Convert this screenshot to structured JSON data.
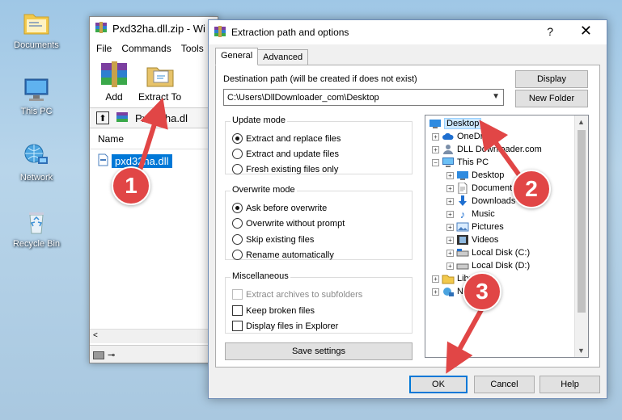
{
  "desktop": {
    "icons": [
      {
        "label": "Documents"
      },
      {
        "label": "This PC"
      },
      {
        "label": "Network"
      },
      {
        "label": "Recycle Bin"
      }
    ]
  },
  "winrar": {
    "title": "Pxd32ha.dll.zip - Wi",
    "menu": [
      "File",
      "Commands",
      "Tools"
    ],
    "toolbar": {
      "add": "Add",
      "extract_to": "Extract To"
    },
    "path": "Pxd32ha.dl",
    "column_name": "Name",
    "file": "pxd32ha.dll"
  },
  "dialog": {
    "title": "Extraction path and options",
    "help": "?",
    "close": "✕",
    "tabs": [
      "General",
      "Advanced"
    ],
    "destination_label": "Destination path (will be created if does not exist)",
    "destination_value": "C:\\Users\\DllDownloader_com\\Desktop",
    "display_button": "Display",
    "new_folder_button": "New Folder",
    "update_mode": {
      "title": "Update mode",
      "options": [
        "Extract and replace files",
        "Extract and update files",
        "Fresh existing files only"
      ],
      "selected": 0
    },
    "overwrite_mode": {
      "title": "Overwrite mode",
      "options": [
        "Ask before overwrite",
        "Overwrite without prompt",
        "Skip existing files",
        "Rename automatically"
      ],
      "selected": 0
    },
    "misc": {
      "title": "Miscellaneous",
      "options": [
        "Extract archives to subfolders",
        "Keep broken files",
        "Display files in Explorer"
      ]
    },
    "save_settings": "Save settings",
    "ok": "OK",
    "cancel": "Cancel",
    "help_button": "Help",
    "tree": [
      {
        "label": "Desktop"
      },
      {
        "label": "OneDri"
      },
      {
        "label": "DLL Downloader.com"
      },
      {
        "label": "This PC"
      },
      {
        "label": "Desktop"
      },
      {
        "label": "Documents"
      },
      {
        "label": "Downloads"
      },
      {
        "label": "Music"
      },
      {
        "label": "Pictures"
      },
      {
        "label": "Videos"
      },
      {
        "label": "Local Disk (C:)"
      },
      {
        "label": "Local Disk (D:)"
      },
      {
        "label": "Libra"
      },
      {
        "label": "Ne"
      }
    ]
  },
  "markers": [
    "1",
    "2",
    "3"
  ],
  "colors": {
    "marker": "#e14646",
    "selection": "#0078d7",
    "arrow": "#e14646"
  }
}
